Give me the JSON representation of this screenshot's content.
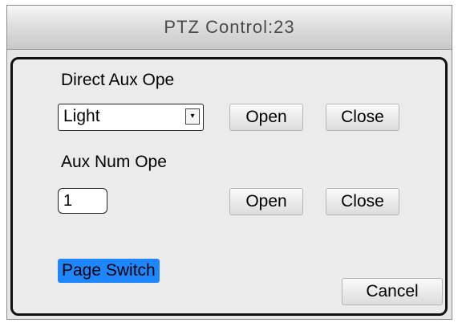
{
  "title": "PTZ Control:23",
  "direct_aux": {
    "label": "Direct Aux Ope",
    "select_value": "Light",
    "open_label": "Open",
    "close_label": "Close"
  },
  "aux_num": {
    "label": "Aux Num Ope",
    "input_value": "1",
    "open_label": "Open",
    "close_label": "Close"
  },
  "footer": {
    "page_switch_label": "Page Switch",
    "cancel_label": "Cancel"
  }
}
